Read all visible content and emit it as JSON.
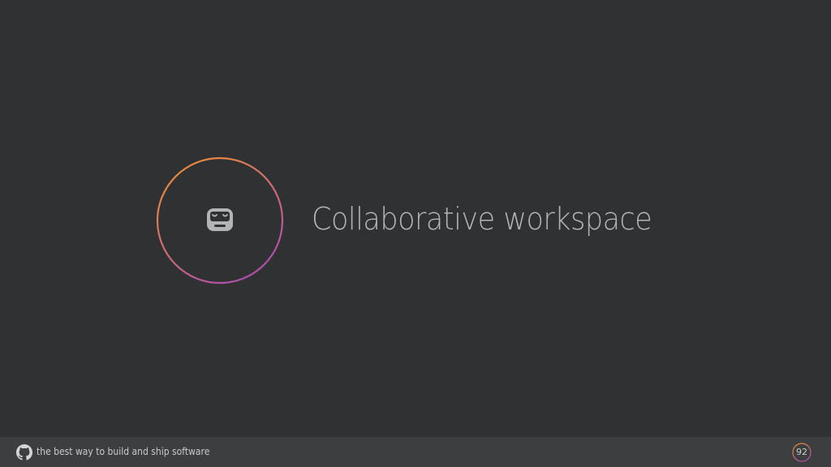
{
  "slide": {
    "title": "Collaborative workspace",
    "icon": "toolbox-robot-icon",
    "ring_colors": {
      "start": "#f0932b",
      "end": "#b14fa8"
    }
  },
  "footer": {
    "logo_icon": "github-octocat-icon",
    "tagline": "the best way to build and ship software",
    "page_number": "92"
  },
  "colors": {
    "background": "#2f3133",
    "footer_background": "#3d3e40",
    "title_text": "#b3b4b6"
  }
}
